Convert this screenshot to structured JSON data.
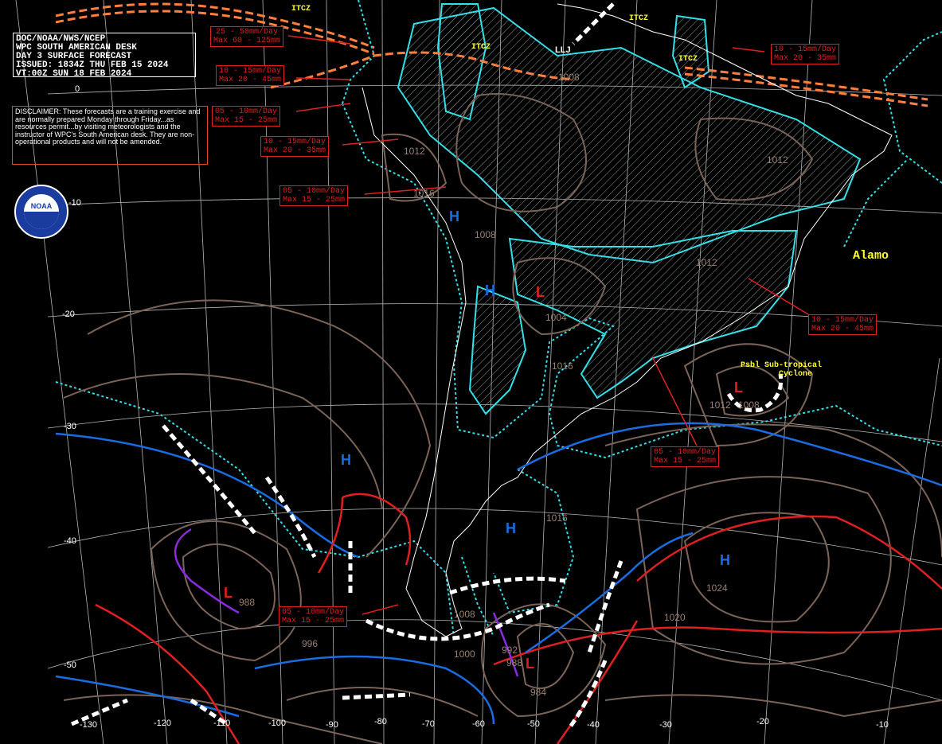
{
  "header": {
    "line1": "DOC/NOAA/NWS/NCEP",
    "line2": "WPC SOUTH AMERICAN DESK",
    "line3": "DAY 3 SURFACE FORECAST",
    "line4": "ISSUED: 1834Z THU FEB 15 2024",
    "line5": "VT:00Z SUN 18 FEB 2024"
  },
  "disclaimer": "DISCLAIMER: These forecasts are a training exercise and are normally prepared Monday through Friday...as resources permit...by visiting meteorologists and the instructor of WPC's South American desk. They are non-operational products and will not be amended.",
  "logo_text": "NOAA",
  "credit": "Alamo",
  "itcz_label": "ITCZ",
  "subtropical": {
    "line1": "Psbl Sub-tropical",
    "line2": "Cyclone"
  },
  "qpf_boxes": [
    {
      "l1": "25 - 50mm/Day",
      "l2": "Max 60 - 125mm"
    },
    {
      "l1": "10 - 15mm/Day",
      "l2": "Max 20 - 45mm"
    },
    {
      "l1": "05 - 10mm/Day",
      "l2": "Max 15 - 25mm"
    },
    {
      "l1": "10 - 15mm/Day",
      "l2": "Max 20 - 35mm"
    },
    {
      "l1": "05 - 10mm/Day",
      "l2": "Max 15 - 25mm"
    },
    {
      "l1": "10 - 15mm/Day",
      "l2": "Max 20 - 35mm"
    },
    {
      "l1": "10 - 15mm/Day",
      "l2": "Max 20 - 45mm"
    },
    {
      "l1": "05 - 10mm/Day",
      "l2": "Max 15 - 25mm"
    },
    {
      "l1": "05 - 10mm/Day",
      "l2": "Max 15 - 25mm"
    }
  ],
  "lat_labels": [
    "0",
    "-10",
    "-20",
    "-30",
    "-40",
    "-50"
  ],
  "lon_labels": [
    "-130",
    "-120",
    "-110",
    "-100",
    "-90",
    "-80",
    "-70",
    "-60",
    "-50",
    "-40",
    "-30",
    "-20",
    "-10"
  ],
  "pressure_labels": [
    "1012",
    "1016",
    "1008",
    "1012",
    "1004",
    "1016",
    "1008",
    "1012",
    "1008",
    "1016",
    "1024",
    "1020",
    "1008",
    "1000",
    "988",
    "996",
    "992",
    "988",
    "984",
    "1012"
  ],
  "centers": {
    "high": "H",
    "low": "L"
  },
  "trough_label": "LLJ",
  "colors": {
    "background": "#000000",
    "isobar": "#7a6458",
    "cold_front": "#1a6ce0",
    "warm_front": "#e02020",
    "occluded_front": "#8a2be2",
    "qpf_outline": "#33e0e8",
    "itcz": "#ff7f3f",
    "coast": "#ffffff",
    "grid": "#d8d8d8",
    "label_yellow": "#ffff33"
  }
}
